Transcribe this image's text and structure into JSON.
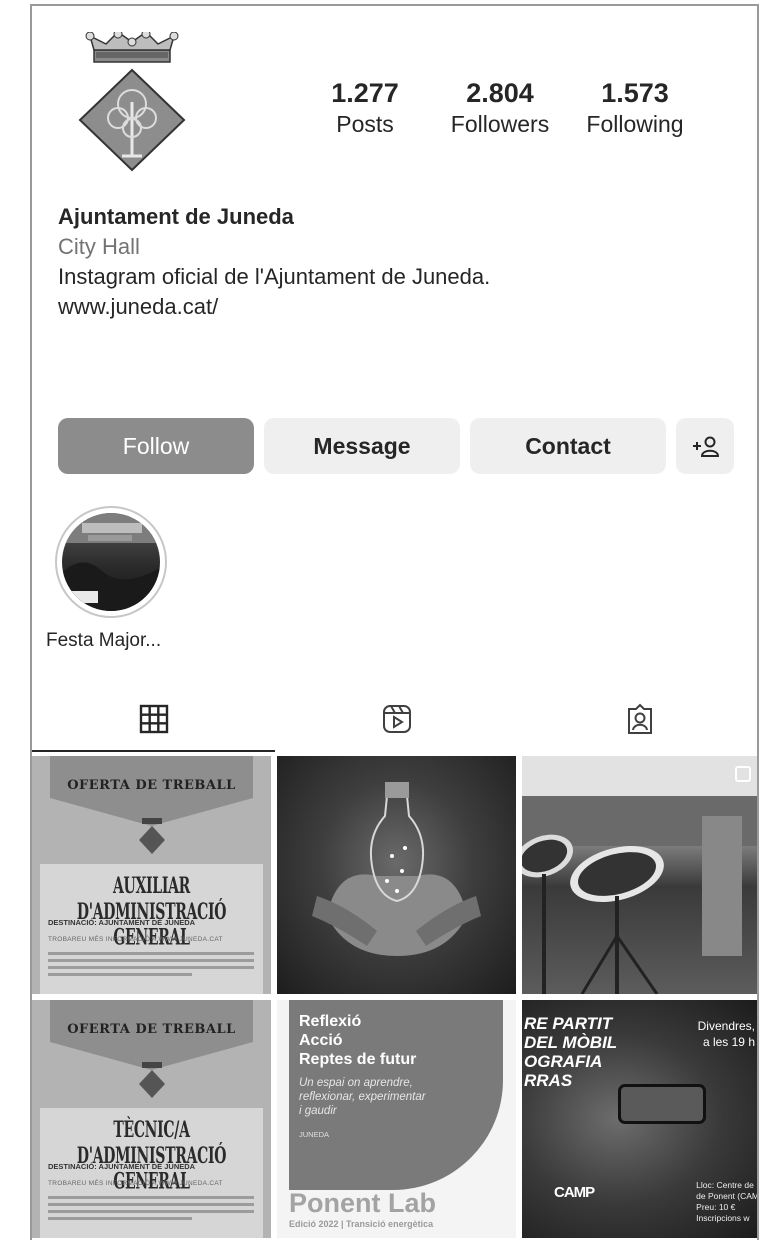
{
  "profile": {
    "name": "Ajuntament de Juneda",
    "category": "City Hall",
    "bio": "Instagram oficial de l'Ajuntament de Juneda.",
    "link": "www.juneda.cat/"
  },
  "stats": [
    {
      "value": "1.277",
      "label": "Posts"
    },
    {
      "value": "2.804",
      "label": "Followers"
    },
    {
      "value": "1.573",
      "label": "Following"
    }
  ],
  "buttons": {
    "follow": "Follow",
    "message": "Message",
    "contact": "Contact",
    "suggest": "+ Ω"
  },
  "highlights": [
    {
      "label": "Festa Major..."
    }
  ],
  "tabs": [
    {
      "icon": "grid-icon"
    },
    {
      "icon": "reels-icon"
    },
    {
      "icon": "tagged-icon"
    }
  ],
  "posts": {
    "p1": {
      "banner": "OFERTA DE TREBALL",
      "title": "AUXILIAR D'ADMINISTRACIÓ GENERAL",
      "dest": "DESTINACIÓ: AJUNTAMENT DE JUNEDA",
      "more": "TROBAREU MÉS INFORMACIÓ A WWW.JUNEDA.CAT"
    },
    "p4": {
      "banner": "OFERTA DE TREBALL",
      "title": "TÈCNIC/A D'ADMINISTRACIÓ GENERAL",
      "dest": "DESTINACIÓ: AJUNTAMENT DE JUNEDA",
      "more": "TROBAREU MÉS INFORMACIÓ A WWW.JUNEDA.CAT"
    },
    "p5": {
      "h1": "Reflexió",
      "h2": "Acció",
      "h3": "Reptes de futur",
      "sub": "Un espai on aprendre, reflexionar, experimentar i gaudir",
      "place": "JUNEDA",
      "lab": "Ponent Lab",
      "edition": "Edició 2022 | Transició energètica"
    },
    "p6": {
      "l1": "RE PARTIT",
      "l2": "DEL MÒBIL",
      "l3": "OGRAFIA",
      "l4": "RRAS",
      "r1": "Divendres,",
      "r2": "a les 19 h",
      "camp": "CAMP",
      "i1": "Lloc: Centre de",
      "i2": "de Ponent (CAM",
      "i3": "Preu: 10 €",
      "i4": "Inscripcions w"
    }
  }
}
